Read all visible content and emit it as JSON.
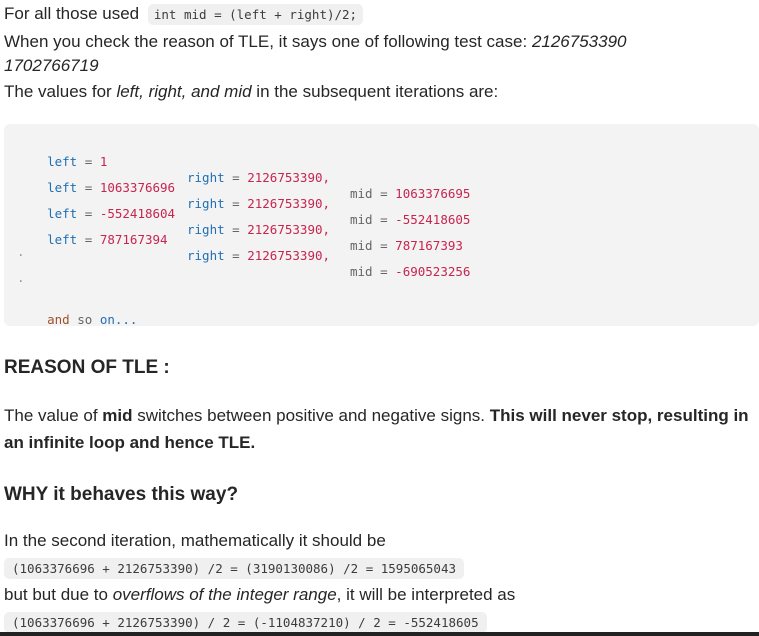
{
  "intro": {
    "line1_text": "For all those used",
    "line1_code": "int mid = (left + right)/2;",
    "line2_text": "When you check the reason of TLE, it says one of following test case:",
    "line2_num": "2126753390",
    "line3_num": "1702766719",
    "line4_pre": "The values for ",
    "line4_em": "left, right, and mid",
    "line4_post": " in the subsequent iterations are:"
  },
  "code_rows": [
    {
      "left": "1",
      "right": "2126753390,",
      "mid": "1063376695"
    },
    {
      "left": "1063376696",
      "right": "2126753390,",
      "mid": "-552418605"
    },
    {
      "left": "-552418604",
      "right": "2126753390,",
      "mid": "787167393"
    },
    {
      "left": "787167394",
      "right": "2126753390,",
      "mid": "-690523256"
    }
  ],
  "code_labels": {
    "left": "left",
    "right": "right",
    "mid": "mid",
    "eq": "="
  },
  "code_dots": [
    ".",
    "."
  ],
  "code_tail": {
    "a": "and",
    "b": "so",
    "c": "on..."
  },
  "reason": {
    "heading": "REASON OF TLE :",
    "pre": "The value of ",
    "bold1": "mid",
    "mid": " switches between positive and negative signs. ",
    "bold2": "This will never stop, resulting in an infinite loop and hence TLE."
  },
  "why": {
    "heading": "WHY it behaves this way?",
    "line1": "In the second iteration, mathematically it should be",
    "math1": "(1063376696 + 2126753390) /2 = (3190130086) /2 = 1595065043",
    "line2_pre": "but but due to ",
    "line2_em": "overflows of the integer range",
    "line2_post": ", it will be interpreted as",
    "math2": "(1063376696 + 2126753390) / 2 = (-1104837210) / 2 = -552418605"
  }
}
